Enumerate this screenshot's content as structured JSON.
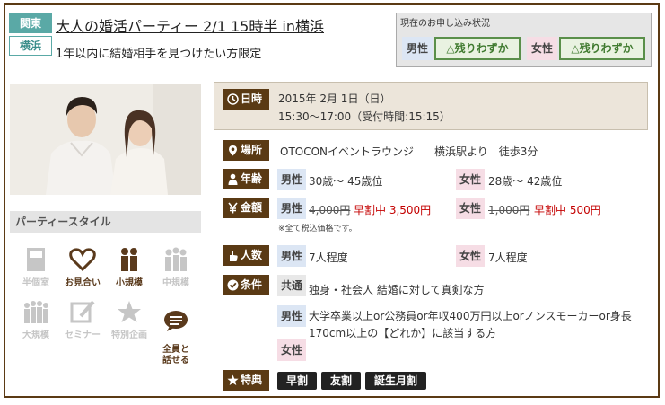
{
  "header": {
    "region_tag": "関東",
    "city_tag": "横浜",
    "title": "大人の婚活パーティー 2/1 15時半 in横浜",
    "subtitle": "1年以内に結婚相手を見つけたい方限定"
  },
  "status": {
    "heading": "現在のお申し込み状況",
    "male_label": "男性",
    "male_status": "△残りわずか",
    "female_label": "女性",
    "female_status": "△残りわずか"
  },
  "party_style": {
    "heading": "パーティースタイル",
    "items": [
      {
        "label": "半個室",
        "icon": "door-icon",
        "active": false
      },
      {
        "label": "お見合い",
        "icon": "heart-icon",
        "active": true
      },
      {
        "label": "小規模",
        "icon": "small-group-icon",
        "active": true
      },
      {
        "label": "中規模",
        "icon": "medium-group-icon",
        "active": false
      },
      {
        "label": "大規模",
        "icon": "large-group-icon",
        "active": false
      },
      {
        "label": "セミナー",
        "icon": "pen-icon",
        "active": false
      },
      {
        "label": "特別企画",
        "icon": "star-icon",
        "active": false
      },
      {
        "label": "全員と\n話せる",
        "icon": "speech-bubble-icon",
        "active": true
      }
    ]
  },
  "details": {
    "date": {
      "label": "日時",
      "line1": "2015年 2月 1日（日）",
      "line2": "15:30〜17:00（受付時間:15:15）"
    },
    "place": {
      "label": "場所",
      "venue": "OTOCONイベントラウンジ",
      "access": "横浜駅より　徒歩3分"
    },
    "age": {
      "label": "年齢",
      "male": "男性",
      "male_value": "30歳〜 45歳位",
      "female": "女性",
      "female_value": "28歳〜 42歳位"
    },
    "price": {
      "label": "金額",
      "male": "男性",
      "male_regular": "4,000円",
      "male_discount": "早割中 3,500円",
      "female": "女性",
      "female_regular": "1,000円",
      "female_discount": "早割中 500円",
      "note": "※全て税込価格です。"
    },
    "count": {
      "label": "人数",
      "male": "男性",
      "male_value": "7人程度",
      "female": "女性",
      "female_value": "7人程度"
    },
    "conditions": {
      "label": "条件",
      "common": "共通",
      "common_value": "独身・社会人 結婚に対して真剣な方",
      "male": "男性",
      "male_value_1": "大学卒業以上or公務員or年収400万円以上orノンスモーカーor身長",
      "male_value_2": "170cm以上の【どれか】に該当する方",
      "female": "女性"
    },
    "perks": {
      "label": "特典",
      "items": [
        "早割",
        "友割",
        "誕生月割"
      ]
    }
  },
  "colors": {
    "brand_brown": "#5a3a14",
    "accent_teal": "#5aa9a6",
    "discount_red": "#c40000",
    "status_green": "#5a8f4a"
  }
}
